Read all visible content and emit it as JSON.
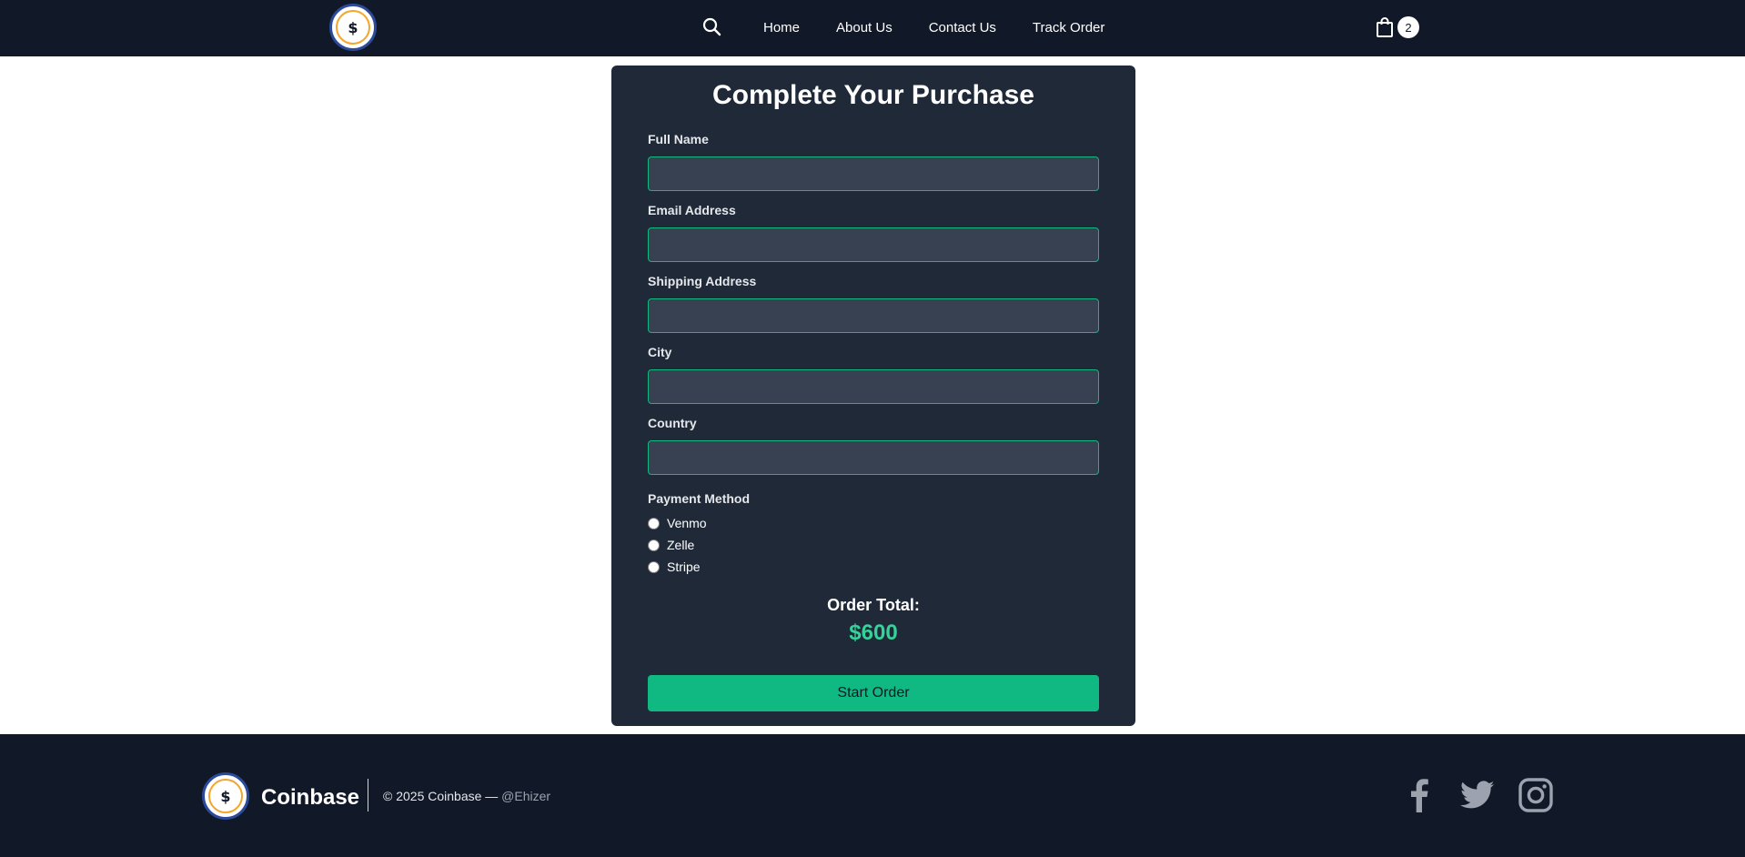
{
  "nav": {
    "logo_symbol": "$",
    "links": [
      "Home",
      "About Us",
      "Contact Us",
      "Track Order"
    ],
    "cart_count": "2",
    "icons": {
      "search": "search-icon",
      "cart": "shopping-bag-icon"
    }
  },
  "form": {
    "title": "Complete Your Purchase",
    "fields": [
      {
        "label": "Full Name",
        "value": "",
        "placeholder": ""
      },
      {
        "label": "Email Address",
        "value": "",
        "placeholder": ""
      },
      {
        "label": "Shipping Address",
        "value": "",
        "placeholder": ""
      },
      {
        "label": "City",
        "value": "",
        "placeholder": ""
      },
      {
        "label": "Country",
        "value": "",
        "placeholder": ""
      }
    ],
    "payment_label": "Payment Method",
    "payment_options": [
      "Venmo",
      "Zelle",
      "Stripe"
    ],
    "total_label": "Order Total:",
    "total_value": "$600",
    "submit_label": "Start Order"
  },
  "footer": {
    "logo_symbol": "$",
    "brand": "Coinbase",
    "copyright": "© 2025 Coinbase — ",
    "handle": "@Ehizer",
    "social": [
      "facebook-icon",
      "twitter-icon",
      "instagram-icon"
    ]
  },
  "colors": {
    "nav_bg": "#111827",
    "card_bg": "#1f2937",
    "input_bg": "#374151",
    "accent": "#10b981",
    "total_color": "#34d399",
    "logo_ring": "#f4a52a",
    "logo_border": "#2c4a9a"
  }
}
